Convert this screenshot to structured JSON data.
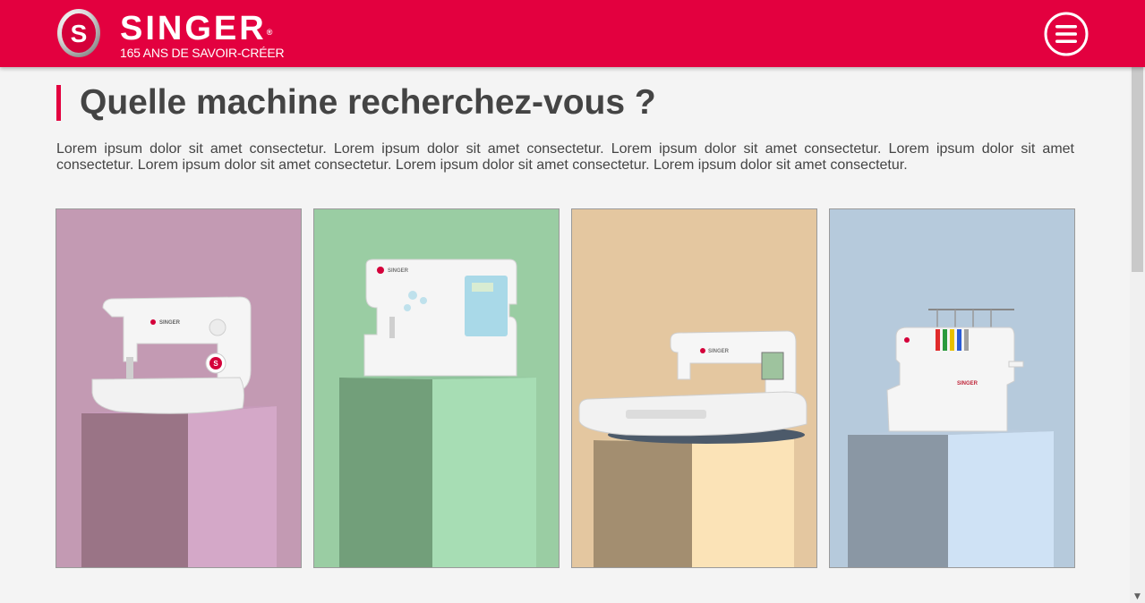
{
  "header": {
    "brand_name": "SINGER",
    "brand_mark": "®",
    "tagline": "165 ANS DE SAVOIR-CRÉER",
    "logo_icon": "singer-s-badge-icon",
    "menu_icon": "hamburger-menu-icon",
    "accent_color": "#e3003f"
  },
  "main": {
    "title": "Quelle machine recherchez-vous ?",
    "intro": "Lorem ipsum dolor sit amet consectetur. Lorem ipsum dolor sit amet consectetur. Lorem ipsum dolor sit amet consectetur. Lorem ipsum dolor sit amet consectetur. Lorem ipsum dolor sit amet consectetur. Lorem ipsum dolor sit amet consectetur. Lorem ipsum dolor sit amet consectetur.",
    "cards": [
      {
        "image": "sewing-machine-on-pink-pedestal",
        "background": "#c39ab3",
        "machine_label": "SINGER"
      },
      {
        "image": "computerized-sewing-machine-on-green-pedestal",
        "background": "#9acda3",
        "machine_label": "SINGER"
      },
      {
        "image": "embroidery-machine-on-beige-pedestal",
        "background": "#e4c7a0",
        "machine_label": "SINGER"
      },
      {
        "image": "serger-machine-on-blue-pedestal",
        "background": "#b6cadc",
        "machine_label": "SINGER"
      }
    ]
  }
}
